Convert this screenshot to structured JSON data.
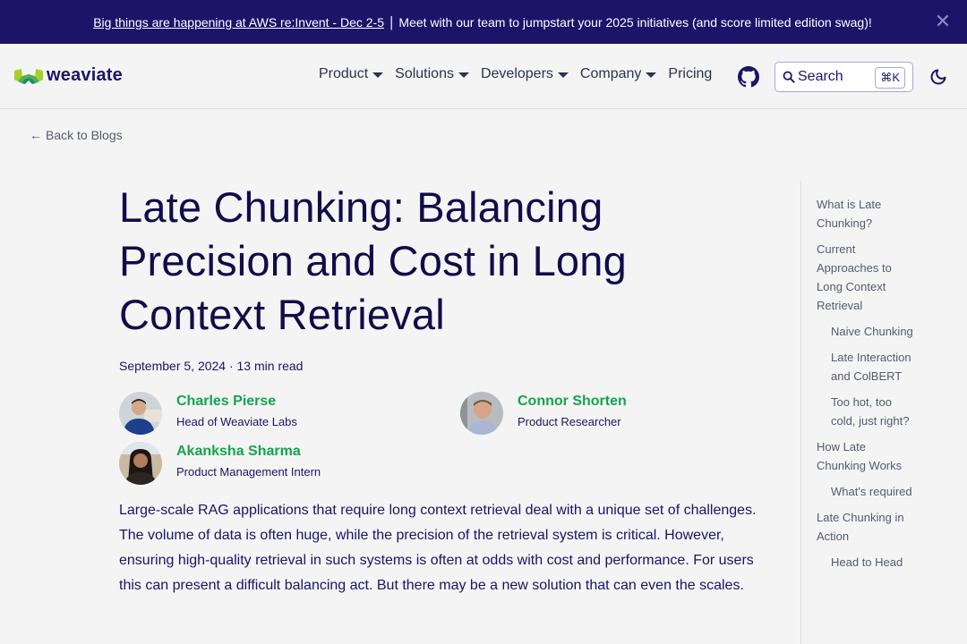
{
  "announcement": {
    "link_text": "Big things are happening at AWS re:Invent - Dec 2-5",
    "separator": "|",
    "message": "Meet with our team to jumpstart your 2025 initiatives (and score limited edition swag)!",
    "close_icon": "close-icon",
    "close_glyph": "✕"
  },
  "navbar": {
    "logo_text": "weaviate",
    "items": [
      {
        "label": "Product",
        "has_dropdown": true
      },
      {
        "label": "Solutions",
        "has_dropdown": true
      },
      {
        "label": "Developers",
        "has_dropdown": true
      },
      {
        "label": "Company",
        "has_dropdown": true
      },
      {
        "label": "Pricing",
        "has_dropdown": false
      }
    ],
    "github_icon": "github-icon",
    "search": {
      "label": "Search",
      "shortcut": "⌘K"
    },
    "theme_toggle_icon": "moon-icon"
  },
  "back_link": {
    "arrow": "←",
    "label": "Back to Blogs"
  },
  "article": {
    "title": "Late Chunking: Balancing Precision and Cost in Long Context Retrieval",
    "meta": "September 5, 2024 · 13 min read",
    "authors": [
      {
        "name": "Charles Pierse",
        "role": "Head of Weaviate Labs"
      },
      {
        "name": "Connor Shorten",
        "role": "Product Researcher"
      },
      {
        "name": "Akanksha Sharma",
        "role": "Product Management Intern"
      }
    ],
    "intro": "Large-scale RAG applications that require long context retrieval deal with a unique set of challenges. The volume of data is often huge, while the precision of the retrieval system is critical. However, ensuring high-quality retrieval in such systems is often at odds with cost and performance. For users this can present a difficult balancing act. But there may be a new solution that can even the scales."
  },
  "toc": [
    {
      "label": "What is Late Chunking?",
      "level": 1
    },
    {
      "label": "Current Approaches to Long Context Retrieval",
      "level": 1
    },
    {
      "label": "Naive Chunking",
      "level": 2
    },
    {
      "label": "Late Interaction and ColBERT",
      "level": 2
    },
    {
      "label": "Too hot, too cold, just right?",
      "level": 2
    },
    {
      "label": "How Late Chunking Works",
      "level": 1
    },
    {
      "label": "What's required",
      "level": 2
    },
    {
      "label": "Late Chunking in Action",
      "level": 1
    },
    {
      "label": "Head to Head",
      "level": 2
    }
  ],
  "colors": {
    "brand_navy": "#1c1468",
    "author_green": "#13a54d",
    "background": "#f4f4f4"
  }
}
